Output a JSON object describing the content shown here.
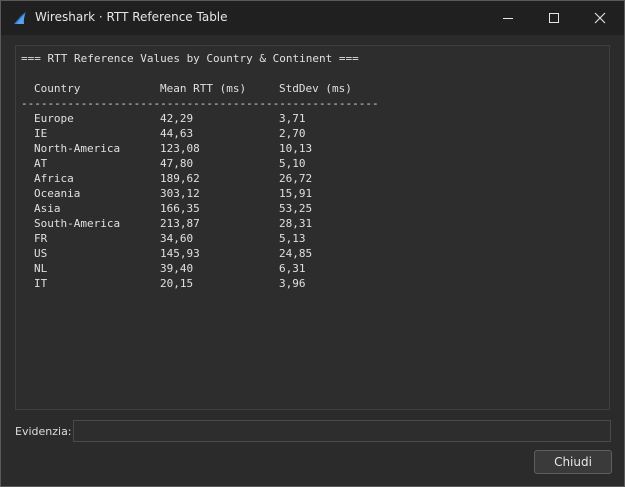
{
  "window": {
    "title": "Wireshark · RTT Reference Table"
  },
  "report": {
    "header": "=== RTT Reference Values by Country & Continent ===",
    "columns": {
      "country": "Country",
      "mean": "Mean RTT (ms)",
      "stddev": "StdDev (ms)"
    },
    "separator": "------------------------------------------------------",
    "rows": [
      {
        "country": "Europe",
        "mean": "42,29",
        "stddev": "3,71"
      },
      {
        "country": "IE",
        "mean": "44,63",
        "stddev": "2,70"
      },
      {
        "country": "North-America",
        "mean": "123,08",
        "stddev": "10,13"
      },
      {
        "country": "AT",
        "mean": "47,80",
        "stddev": "5,10"
      },
      {
        "country": "Africa",
        "mean": "189,62",
        "stddev": "26,72"
      },
      {
        "country": "Oceania",
        "mean": "303,12",
        "stddev": "15,91"
      },
      {
        "country": "Asia",
        "mean": "166,35",
        "stddev": "53,25"
      },
      {
        "country": "South-America",
        "mean": "213,87",
        "stddev": "28,31"
      },
      {
        "country": "FR",
        "mean": "34,60",
        "stddev": "5,13"
      },
      {
        "country": "US",
        "mean": "145,93",
        "stddev": "24,85"
      },
      {
        "country": "NL",
        "mean": "39,40",
        "stddev": "6,31"
      },
      {
        "country": "IT",
        "mean": "20,15",
        "stddev": "3,96"
      }
    ]
  },
  "search": {
    "label": "Evidenzia:",
    "value": "",
    "placeholder": ""
  },
  "buttons": {
    "close_label": "Chiudi"
  },
  "icons": {
    "app": "wireshark-fin-icon",
    "minimize": "minimize-icon",
    "maximize": "maximize-icon",
    "close": "close-icon"
  },
  "colors": {
    "accent": "#2f7fd8",
    "background": "#2b2b2b",
    "titlebar": "#202020",
    "text": "#e0e0e0"
  }
}
